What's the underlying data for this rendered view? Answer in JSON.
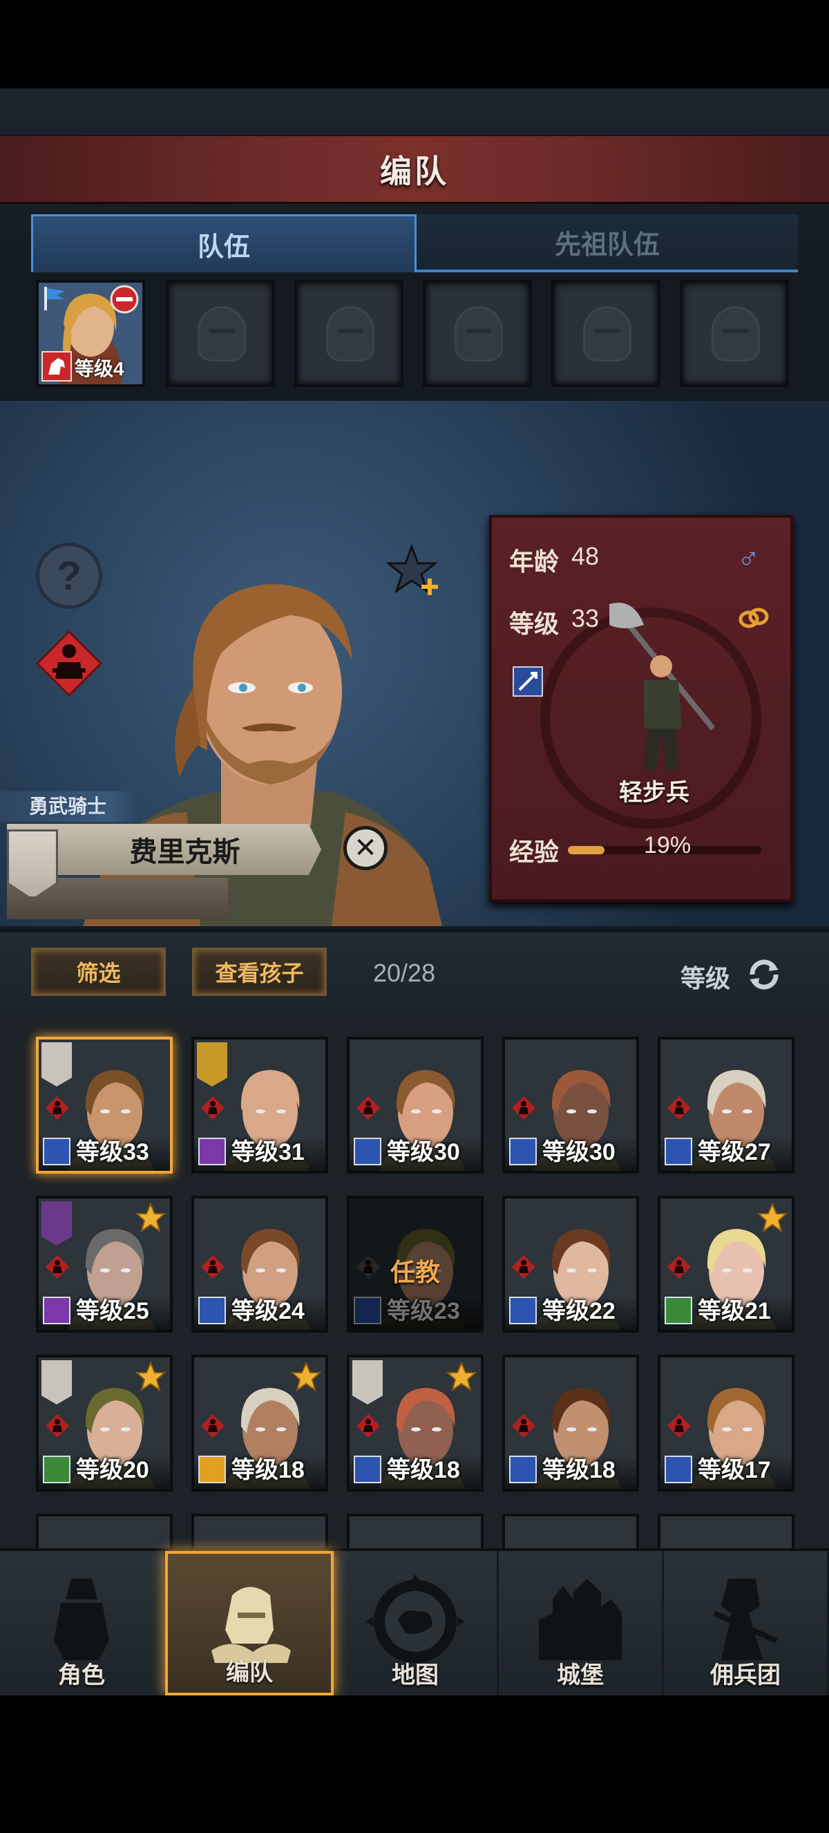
{
  "title": "编队",
  "tabs": [
    {
      "label": "队伍",
      "active": true
    },
    {
      "label": "先祖队伍",
      "active": false
    }
  ],
  "team_slot": {
    "level": "等级4"
  },
  "hero": {
    "title": "勇武骑士",
    "name": "费里克斯",
    "stats": {
      "age_label": "年龄",
      "age": "48",
      "level_label": "等级",
      "level": "33",
      "unit_type": "轻步兵",
      "exp_label": "经验",
      "exp": "19%",
      "exp_fraction": 0.19
    }
  },
  "filter_bar": {
    "filter_label": "筛选",
    "children_label": "查看孩子",
    "count": "20/28",
    "sort_label": "等级"
  },
  "roster": [
    {
      "level": "等级33",
      "cls": "blue",
      "banner": "white",
      "selected": true,
      "star": false,
      "skin": "#c9956c",
      "hair": "#7a5028"
    },
    {
      "level": "等级31",
      "cls": "purple",
      "banner": "gold",
      "selected": false,
      "star": false,
      "skin": "#d9a888",
      "hair": "#d9a888"
    },
    {
      "level": "等级30",
      "cls": "blue",
      "banner": "",
      "selected": false,
      "star": false,
      "skin": "#d8a080",
      "hair": "#8a5a30"
    },
    {
      "level": "等级30",
      "cls": "blue",
      "banner": "",
      "selected": false,
      "star": false,
      "skin": "#7a5040",
      "hair": "#9a5a3a"
    },
    {
      "level": "等级27",
      "cls": "blue",
      "banner": "",
      "selected": false,
      "star": false,
      "skin": "#c08a6a",
      "hair": "#d8d0c0"
    },
    {
      "level": "等级25",
      "cls": "purple",
      "banner": "purple",
      "selected": false,
      "star": true,
      "skin": "#c0a090",
      "hair": "#6a6a6a"
    },
    {
      "level": "等级24",
      "cls": "blue",
      "banner": "",
      "selected": false,
      "star": false,
      "skin": "#d0a080",
      "hair": "#7a4a28"
    },
    {
      "level": "等级23",
      "cls": "blue",
      "banner": "",
      "selected": false,
      "star": false,
      "skin": "#c09070",
      "hair": "#6a6a30",
      "dim": true,
      "status": "任教"
    },
    {
      "level": "等级22",
      "cls": "blue",
      "banner": "",
      "selected": false,
      "star": false,
      "skin": "#e0b8a0",
      "hair": "#6a3a20"
    },
    {
      "level": "等级21",
      "cls": "green",
      "banner": "",
      "selected": false,
      "star": true,
      "skin": "#e8c0b0",
      "hair": "#e8d890"
    },
    {
      "level": "等级20",
      "cls": "green",
      "banner": "white",
      "selected": false,
      "star": true,
      "skin": "#d8b098",
      "hair": "#6a6a30"
    },
    {
      "level": "等级18",
      "cls": "gold",
      "banner": "",
      "selected": false,
      "star": true,
      "skin": "#b08060",
      "hair": "#d8d0c0"
    },
    {
      "level": "等级18",
      "cls": "blue",
      "banner": "white",
      "selected": false,
      "star": true,
      "skin": "#906050",
      "hair": "#c06040"
    },
    {
      "level": "等级18",
      "cls": "blue",
      "banner": "",
      "selected": false,
      "star": false,
      "skin": "#c09070",
      "hair": "#5a3018"
    },
    {
      "level": "等级17",
      "cls": "blue",
      "banner": "",
      "selected": false,
      "star": false,
      "skin": "#d8a888",
      "hair": "#a06830"
    }
  ],
  "nav": [
    {
      "label": "角色",
      "icon": "knight-icon",
      "active": false
    },
    {
      "label": "编队",
      "icon": "formation-helmet-icon",
      "active": true
    },
    {
      "label": "地图",
      "icon": "map-compass-icon",
      "active": false
    },
    {
      "label": "城堡",
      "icon": "castle-icon",
      "active": false
    },
    {
      "label": "佣兵团",
      "icon": "mercenary-icon",
      "active": false
    }
  ],
  "colors": {
    "accent": "#f1a63a",
    "tab_blue": "#4c8fd6",
    "banner_red": "#6b2a28",
    "panel_red": "#5a2126"
  }
}
